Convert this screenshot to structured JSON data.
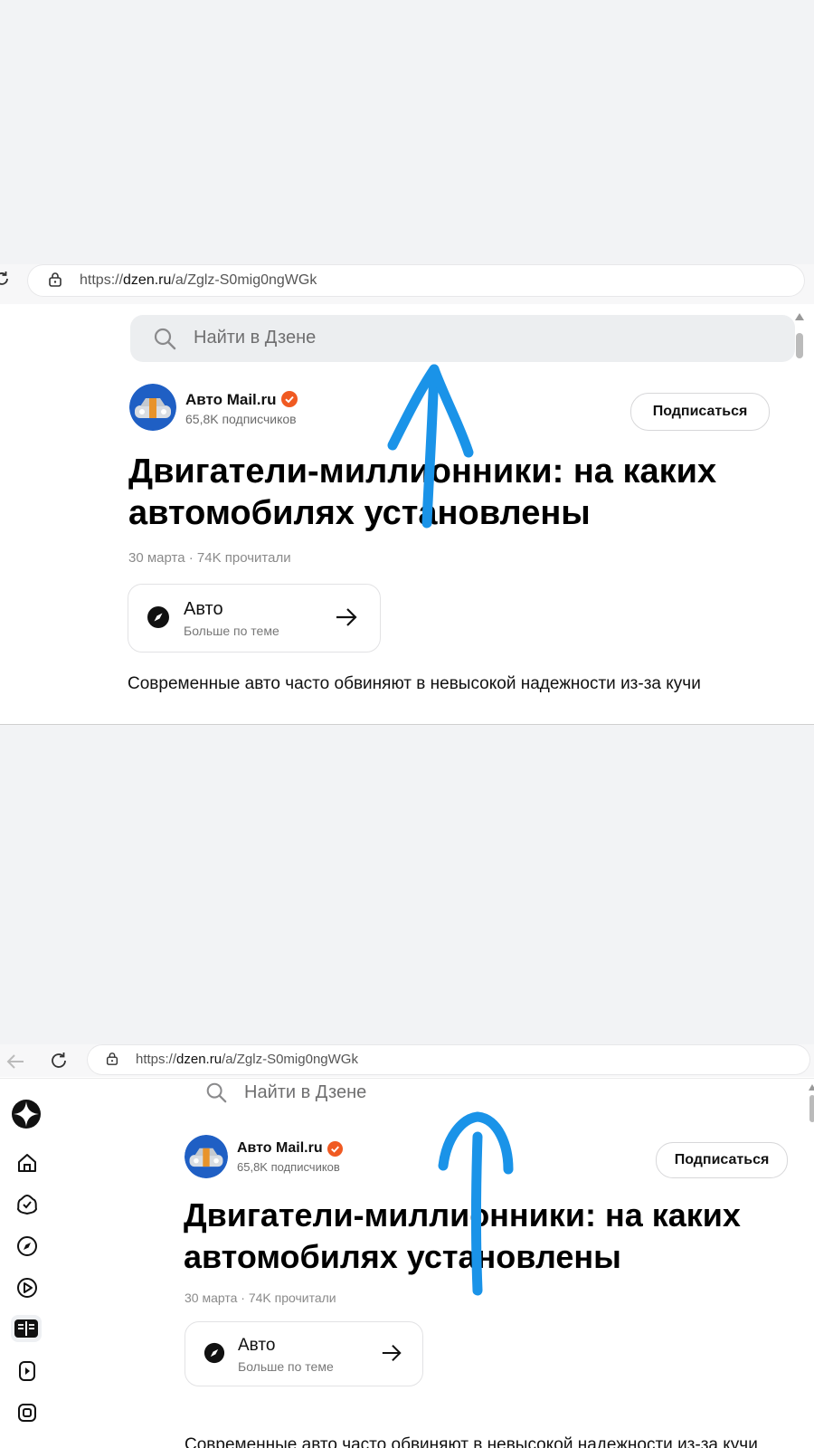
{
  "colors": {
    "annotation": "#1a93e8",
    "verified": "#f05a22",
    "background": "#f2f3f5"
  },
  "top_screenshot": {
    "url_prefix": "https://",
    "url_domain": "dzen.ru",
    "url_path": "/a/Zglz-S0mig0ngWGk",
    "search_placeholder": "Найти в Дзене",
    "channel_name": "Авто Mail.ru",
    "subscribers": "65,8K подписчиков",
    "subscribe_label": "Подписаться",
    "title_line1": "Двигатели-миллионники: на каких",
    "title_line2": "автомобилях установлены",
    "meta": "30 марта · 74K прочитали",
    "topic_name": "Авто",
    "topic_sub": "Больше по теме",
    "body_text": "Современные авто часто обвиняют в невысокой надежности из-за кучи",
    "annotation_icon": "swipe-up-arrow-icon"
  },
  "bottom_screenshot": {
    "url_prefix": "https://",
    "url_domain": "dzen.ru",
    "url_path": "/a/Zglz-S0mig0ngWGk",
    "search_placeholder": "Найти в Дзене",
    "channel_name": "Авто Mail.ru",
    "subscribers": "65,8K подписчиков",
    "subscribe_label": "Подписаться",
    "title_line1": "Двигатели-миллионники: на каких",
    "title_line2": "автомобилях установлены",
    "meta": "30 марта · 74K прочитали",
    "topic_name": "Авто",
    "topic_sub": "Больше по теме",
    "body_text": "Современные авто часто обвиняют в невысокой надежности из-за кучи",
    "sidebar_icons": [
      "home-icon",
      "subscriptions-icon",
      "compass-icon",
      "video-icon",
      "articles-icon",
      "shorts-icon",
      "more-icon"
    ],
    "active_sidebar_icon": "articles-icon",
    "annotation_icon": "swipe-up-arrow-icon"
  }
}
